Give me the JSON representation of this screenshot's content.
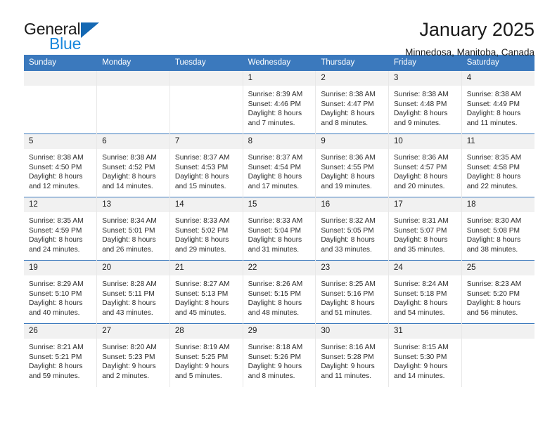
{
  "brand": {
    "name_part1": "General",
    "name_part2": "Blue",
    "logo_icon": "triangle-logo-icon"
  },
  "header": {
    "title": "January 2025",
    "subtitle": "Minnedosa, Manitoba, Canada"
  },
  "colors": {
    "header_blue": "#3b79bd",
    "brand_blue": "#1887dc",
    "logo_blue": "#1468b3",
    "daynum_band": "#f1f1f1",
    "text": "#1b1b1b"
  },
  "weekday_headers": [
    "Sunday",
    "Monday",
    "Tuesday",
    "Wednesday",
    "Thursday",
    "Friday",
    "Saturday"
  ],
  "labels": {
    "sunrise": "Sunrise:",
    "sunset": "Sunset:",
    "daylight": "Daylight:"
  },
  "weeks": [
    [
      {
        "day": "",
        "empty": true
      },
      {
        "day": "",
        "empty": true
      },
      {
        "day": "",
        "empty": true
      },
      {
        "day": "1",
        "sunrise": "Sunrise: 8:39 AM",
        "sunset": "Sunset: 4:46 PM",
        "daylight_line1": "Daylight: 8 hours",
        "daylight_line2": "and 7 minutes."
      },
      {
        "day": "2",
        "sunrise": "Sunrise: 8:38 AM",
        "sunset": "Sunset: 4:47 PM",
        "daylight_line1": "Daylight: 8 hours",
        "daylight_line2": "and 8 minutes."
      },
      {
        "day": "3",
        "sunrise": "Sunrise: 8:38 AM",
        "sunset": "Sunset: 4:48 PM",
        "daylight_line1": "Daylight: 8 hours",
        "daylight_line2": "and 9 minutes."
      },
      {
        "day": "4",
        "sunrise": "Sunrise: 8:38 AM",
        "sunset": "Sunset: 4:49 PM",
        "daylight_line1": "Daylight: 8 hours",
        "daylight_line2": "and 11 minutes."
      }
    ],
    [
      {
        "day": "5",
        "sunrise": "Sunrise: 8:38 AM",
        "sunset": "Sunset: 4:50 PM",
        "daylight_line1": "Daylight: 8 hours",
        "daylight_line2": "and 12 minutes."
      },
      {
        "day": "6",
        "sunrise": "Sunrise: 8:38 AM",
        "sunset": "Sunset: 4:52 PM",
        "daylight_line1": "Daylight: 8 hours",
        "daylight_line2": "and 14 minutes."
      },
      {
        "day": "7",
        "sunrise": "Sunrise: 8:37 AM",
        "sunset": "Sunset: 4:53 PM",
        "daylight_line1": "Daylight: 8 hours",
        "daylight_line2": "and 15 minutes."
      },
      {
        "day": "8",
        "sunrise": "Sunrise: 8:37 AM",
        "sunset": "Sunset: 4:54 PM",
        "daylight_line1": "Daylight: 8 hours",
        "daylight_line2": "and 17 minutes."
      },
      {
        "day": "9",
        "sunrise": "Sunrise: 8:36 AM",
        "sunset": "Sunset: 4:55 PM",
        "daylight_line1": "Daylight: 8 hours",
        "daylight_line2": "and 19 minutes."
      },
      {
        "day": "10",
        "sunrise": "Sunrise: 8:36 AM",
        "sunset": "Sunset: 4:57 PM",
        "daylight_line1": "Daylight: 8 hours",
        "daylight_line2": "and 20 minutes."
      },
      {
        "day": "11",
        "sunrise": "Sunrise: 8:35 AM",
        "sunset": "Sunset: 4:58 PM",
        "daylight_line1": "Daylight: 8 hours",
        "daylight_line2": "and 22 minutes."
      }
    ],
    [
      {
        "day": "12",
        "sunrise": "Sunrise: 8:35 AM",
        "sunset": "Sunset: 4:59 PM",
        "daylight_line1": "Daylight: 8 hours",
        "daylight_line2": "and 24 minutes."
      },
      {
        "day": "13",
        "sunrise": "Sunrise: 8:34 AM",
        "sunset": "Sunset: 5:01 PM",
        "daylight_line1": "Daylight: 8 hours",
        "daylight_line2": "and 26 minutes."
      },
      {
        "day": "14",
        "sunrise": "Sunrise: 8:33 AM",
        "sunset": "Sunset: 5:02 PM",
        "daylight_line1": "Daylight: 8 hours",
        "daylight_line2": "and 29 minutes."
      },
      {
        "day": "15",
        "sunrise": "Sunrise: 8:33 AM",
        "sunset": "Sunset: 5:04 PM",
        "daylight_line1": "Daylight: 8 hours",
        "daylight_line2": "and 31 minutes."
      },
      {
        "day": "16",
        "sunrise": "Sunrise: 8:32 AM",
        "sunset": "Sunset: 5:05 PM",
        "daylight_line1": "Daylight: 8 hours",
        "daylight_line2": "and 33 minutes."
      },
      {
        "day": "17",
        "sunrise": "Sunrise: 8:31 AM",
        "sunset": "Sunset: 5:07 PM",
        "daylight_line1": "Daylight: 8 hours",
        "daylight_line2": "and 35 minutes."
      },
      {
        "day": "18",
        "sunrise": "Sunrise: 8:30 AM",
        "sunset": "Sunset: 5:08 PM",
        "daylight_line1": "Daylight: 8 hours",
        "daylight_line2": "and 38 minutes."
      }
    ],
    [
      {
        "day": "19",
        "sunrise": "Sunrise: 8:29 AM",
        "sunset": "Sunset: 5:10 PM",
        "daylight_line1": "Daylight: 8 hours",
        "daylight_line2": "and 40 minutes."
      },
      {
        "day": "20",
        "sunrise": "Sunrise: 8:28 AM",
        "sunset": "Sunset: 5:11 PM",
        "daylight_line1": "Daylight: 8 hours",
        "daylight_line2": "and 43 minutes."
      },
      {
        "day": "21",
        "sunrise": "Sunrise: 8:27 AM",
        "sunset": "Sunset: 5:13 PM",
        "daylight_line1": "Daylight: 8 hours",
        "daylight_line2": "and 45 minutes."
      },
      {
        "day": "22",
        "sunrise": "Sunrise: 8:26 AM",
        "sunset": "Sunset: 5:15 PM",
        "daylight_line1": "Daylight: 8 hours",
        "daylight_line2": "and 48 minutes."
      },
      {
        "day": "23",
        "sunrise": "Sunrise: 8:25 AM",
        "sunset": "Sunset: 5:16 PM",
        "daylight_line1": "Daylight: 8 hours",
        "daylight_line2": "and 51 minutes."
      },
      {
        "day": "24",
        "sunrise": "Sunrise: 8:24 AM",
        "sunset": "Sunset: 5:18 PM",
        "daylight_line1": "Daylight: 8 hours",
        "daylight_line2": "and 54 minutes."
      },
      {
        "day": "25",
        "sunrise": "Sunrise: 8:23 AM",
        "sunset": "Sunset: 5:20 PM",
        "daylight_line1": "Daylight: 8 hours",
        "daylight_line2": "and 56 minutes."
      }
    ],
    [
      {
        "day": "26",
        "sunrise": "Sunrise: 8:21 AM",
        "sunset": "Sunset: 5:21 PM",
        "daylight_line1": "Daylight: 8 hours",
        "daylight_line2": "and 59 minutes."
      },
      {
        "day": "27",
        "sunrise": "Sunrise: 8:20 AM",
        "sunset": "Sunset: 5:23 PM",
        "daylight_line1": "Daylight: 9 hours",
        "daylight_line2": "and 2 minutes."
      },
      {
        "day": "28",
        "sunrise": "Sunrise: 8:19 AM",
        "sunset": "Sunset: 5:25 PM",
        "daylight_line1": "Daylight: 9 hours",
        "daylight_line2": "and 5 minutes."
      },
      {
        "day": "29",
        "sunrise": "Sunrise: 8:18 AM",
        "sunset": "Sunset: 5:26 PM",
        "daylight_line1": "Daylight: 9 hours",
        "daylight_line2": "and 8 minutes."
      },
      {
        "day": "30",
        "sunrise": "Sunrise: 8:16 AM",
        "sunset": "Sunset: 5:28 PM",
        "daylight_line1": "Daylight: 9 hours",
        "daylight_line2": "and 11 minutes."
      },
      {
        "day": "31",
        "sunrise": "Sunrise: 8:15 AM",
        "sunset": "Sunset: 5:30 PM",
        "daylight_line1": "Daylight: 9 hours",
        "daylight_line2": "and 14 minutes."
      },
      {
        "day": "",
        "empty": true
      }
    ]
  ]
}
